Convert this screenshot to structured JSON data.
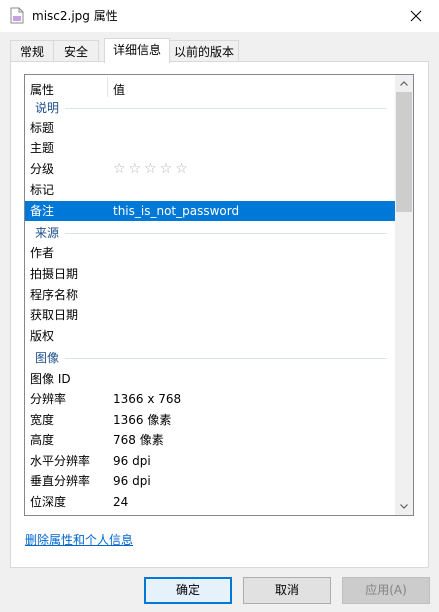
{
  "window": {
    "title": "misc2.jpg 属性"
  },
  "tabs": [
    {
      "label": "常规"
    },
    {
      "label": "安全"
    },
    {
      "label": "详细信息"
    },
    {
      "label": "以前的版本"
    }
  ],
  "details": {
    "header": {
      "property": "属性",
      "value": "值"
    },
    "rating_stars": "☆☆☆☆☆",
    "groups": {
      "description": "说明",
      "origin": "来源",
      "image": "图像"
    },
    "rows": {
      "title": {
        "k": "标题",
        "v": ""
      },
      "subject": {
        "k": "主题",
        "v": ""
      },
      "rating": {
        "k": "分级"
      },
      "tags": {
        "k": "标记",
        "v": ""
      },
      "comments": {
        "k": "备注",
        "v": "this_is_not_password"
      },
      "authors": {
        "k": "作者",
        "v": ""
      },
      "date_taken": {
        "k": "拍摄日期",
        "v": ""
      },
      "program": {
        "k": "程序名称",
        "v": ""
      },
      "date_acquired": {
        "k": "获取日期",
        "v": ""
      },
      "copyright": {
        "k": "版权",
        "v": ""
      },
      "image_id": {
        "k": "图像 ID",
        "v": ""
      },
      "dimensions": {
        "k": "分辨率",
        "v": "1366 x 768"
      },
      "width": {
        "k": "宽度",
        "v": "1366 像素"
      },
      "height": {
        "k": "高度",
        "v": "768 像素"
      },
      "hres": {
        "k": "水平分辨率",
        "v": "96 dpi"
      },
      "vres": {
        "k": "垂直分辨率",
        "v": "96 dpi"
      },
      "bitdepth": {
        "k": "位深度",
        "v": "24"
      }
    }
  },
  "remove_link": "删除属性和个人信息",
  "buttons": {
    "ok": "确定",
    "cancel": "取消",
    "apply": "应用(A)"
  },
  "colors": {
    "selection": "#0078d7",
    "group_text": "#1e4e8c",
    "link": "#0066cc"
  }
}
